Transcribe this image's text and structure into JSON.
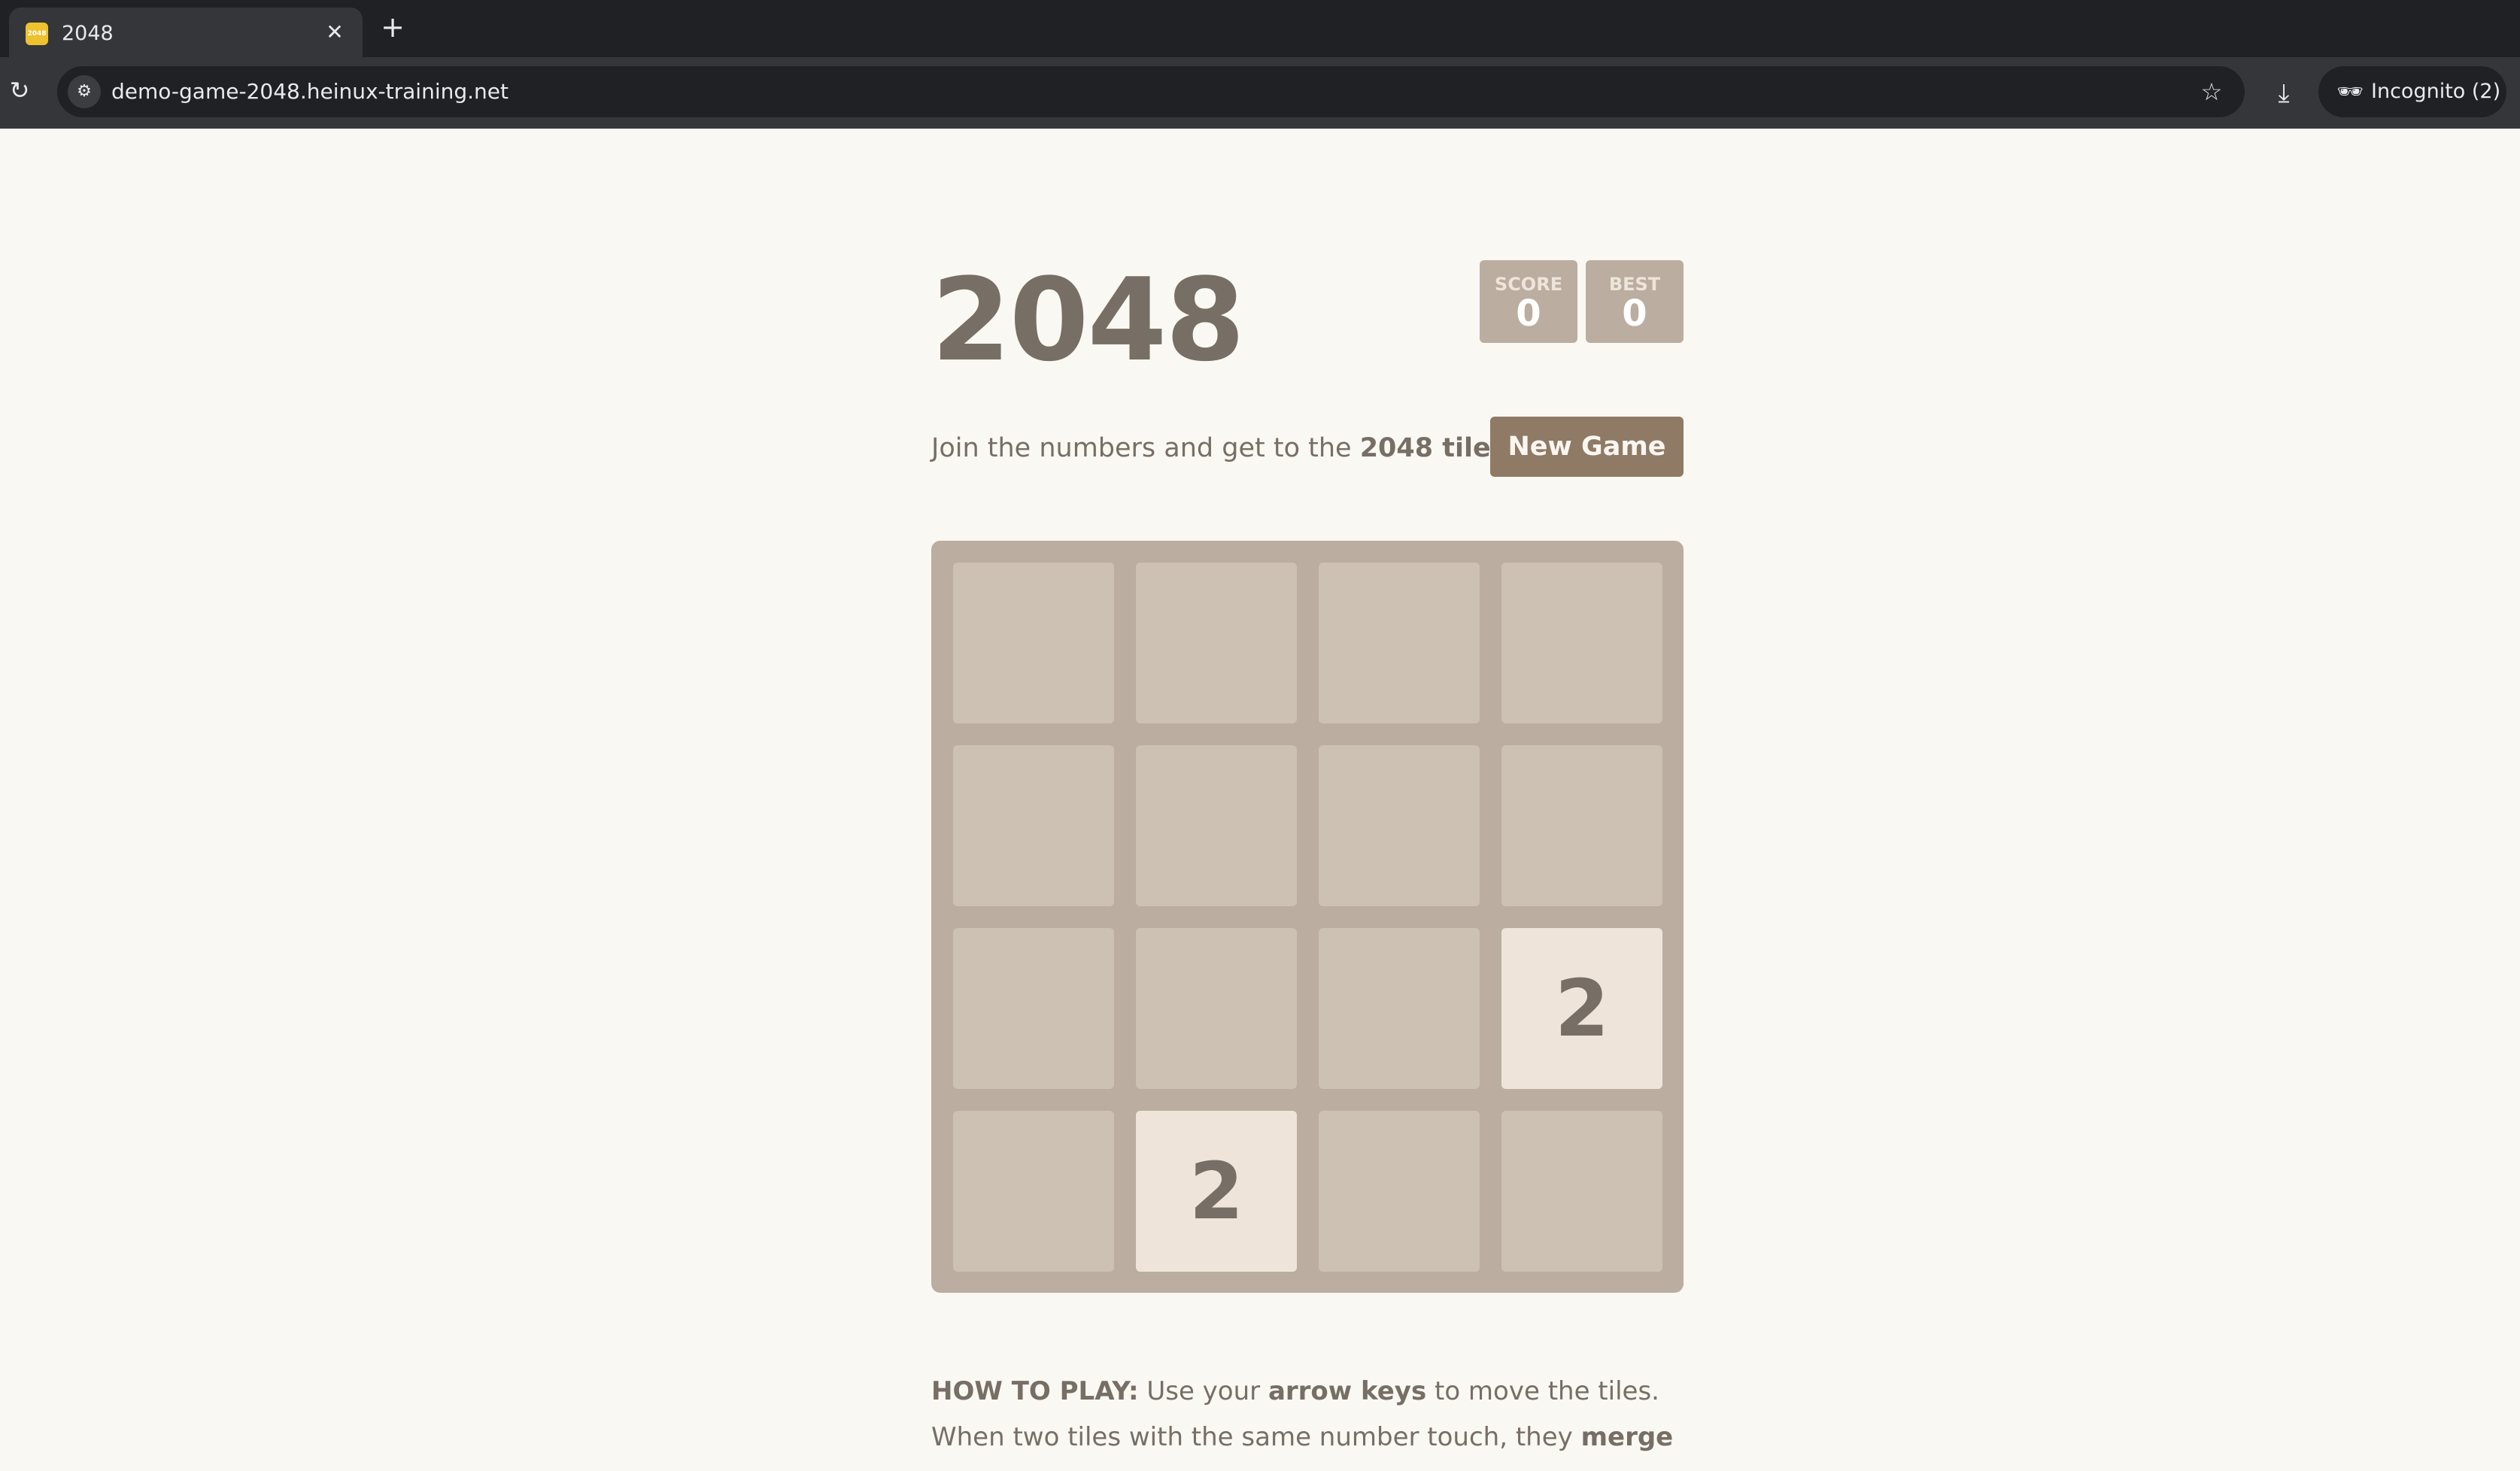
{
  "browser": {
    "tab_title": "2048",
    "favicon_text": "2048",
    "url": "demo-game-2048.heinux-training.net",
    "incognito_label": "Incognito (2)"
  },
  "game": {
    "title": "2048",
    "score": {
      "label": "SCORE",
      "value": "0"
    },
    "best": {
      "label": "BEST",
      "value": "0"
    },
    "intro_text": "Join the numbers and get to the ",
    "intro_bold": "2048 tile!",
    "new_game_label": "New Game",
    "tiles": [
      {
        "row": 2,
        "col": 3,
        "value": "2"
      },
      {
        "row": 3,
        "col": 1,
        "value": "2"
      }
    ],
    "how_to": {
      "label": "HOW TO PLAY:",
      "text1": " Use your ",
      "bold1": "arrow keys",
      "text2": " to move the tiles. When two tiles with the same number touch, they ",
      "bold2": "merge into one!"
    }
  },
  "colors": {
    "board": "#bbada0",
    "empty_cell": "#cdc1b4",
    "tile_2": "#eee4da",
    "text": "#776e65",
    "button": "#8f7a66"
  },
  "icons": [
    "reload-icon",
    "site-info-icon",
    "star-icon",
    "download-icon",
    "incognito-icon",
    "close-icon",
    "plus-icon"
  ]
}
